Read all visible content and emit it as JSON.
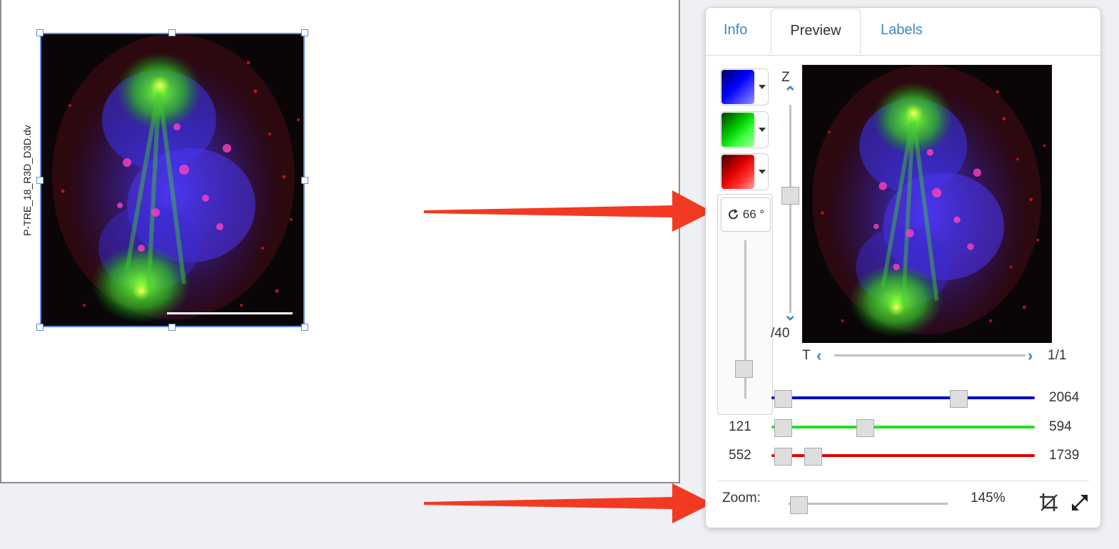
{
  "canvas": {
    "image_label": "P-TRE_18_R3D_D3D.dv"
  },
  "panel": {
    "tabs": [
      {
        "label": "Info",
        "active": false
      },
      {
        "label": "Preview",
        "active": true
      },
      {
        "label": "Labels",
        "active": false
      }
    ],
    "channel_buttons": [
      {
        "color": "#0000ff"
      },
      {
        "color": "#00e000"
      },
      {
        "color": "#e00000"
      }
    ],
    "rotation": {
      "value": "66 °",
      "icon": "rotate-icon"
    },
    "z_axis": {
      "label": "Z",
      "count": "/40"
    },
    "t_axis": {
      "label": "T",
      "count": "1/1"
    },
    "channels": [
      {
        "color": "#0000cc",
        "min": "",
        "max": "2064"
      },
      {
        "color": "#22e022",
        "min": "121",
        "max": "594"
      },
      {
        "color": "#e00000",
        "min": "552",
        "max": "1739"
      }
    ],
    "zoom": {
      "label": "Zoom:",
      "value": "145%"
    }
  }
}
